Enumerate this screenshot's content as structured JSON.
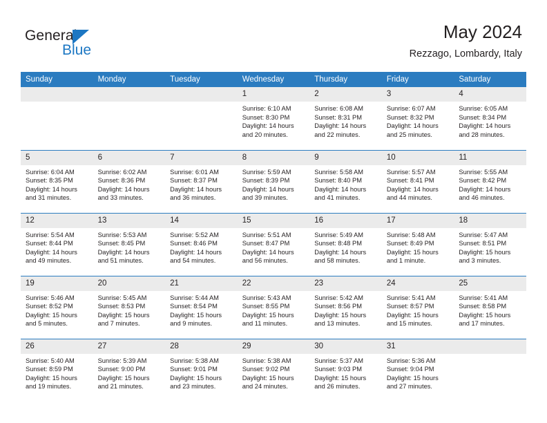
{
  "brand": {
    "name_top": "General",
    "name_bottom": "Blue",
    "triangle_color": "#1c77c3",
    "text_color": "#231f20"
  },
  "header": {
    "title": "May 2024",
    "subtitle": "Rezzago, Lombardy, Italy"
  },
  "theme": {
    "header_blue": "#2b7cc0",
    "daynum_gray": "#ebebeb",
    "text": "#231f20"
  },
  "weekday_headers": [
    "Sunday",
    "Monday",
    "Tuesday",
    "Wednesday",
    "Thursday",
    "Friday",
    "Saturday"
  ],
  "weeks": [
    [
      {
        "day": "",
        "lines": []
      },
      {
        "day": "",
        "lines": []
      },
      {
        "day": "",
        "lines": []
      },
      {
        "day": "1",
        "lines": [
          "Sunrise: 6:10 AM",
          "Sunset: 8:30 PM",
          "Daylight: 14 hours and 20 minutes."
        ]
      },
      {
        "day": "2",
        "lines": [
          "Sunrise: 6:08 AM",
          "Sunset: 8:31 PM",
          "Daylight: 14 hours and 22 minutes."
        ]
      },
      {
        "day": "3",
        "lines": [
          "Sunrise: 6:07 AM",
          "Sunset: 8:32 PM",
          "Daylight: 14 hours and 25 minutes."
        ]
      },
      {
        "day": "4",
        "lines": [
          "Sunrise: 6:05 AM",
          "Sunset: 8:34 PM",
          "Daylight: 14 hours and 28 minutes."
        ]
      }
    ],
    [
      {
        "day": "5",
        "lines": [
          "Sunrise: 6:04 AM",
          "Sunset: 8:35 PM",
          "Daylight: 14 hours and 31 minutes."
        ]
      },
      {
        "day": "6",
        "lines": [
          "Sunrise: 6:02 AM",
          "Sunset: 8:36 PM",
          "Daylight: 14 hours and 33 minutes."
        ]
      },
      {
        "day": "7",
        "lines": [
          "Sunrise: 6:01 AM",
          "Sunset: 8:37 PM",
          "Daylight: 14 hours and 36 minutes."
        ]
      },
      {
        "day": "8",
        "lines": [
          "Sunrise: 5:59 AM",
          "Sunset: 8:39 PM",
          "Daylight: 14 hours and 39 minutes."
        ]
      },
      {
        "day": "9",
        "lines": [
          "Sunrise: 5:58 AM",
          "Sunset: 8:40 PM",
          "Daylight: 14 hours and 41 minutes."
        ]
      },
      {
        "day": "10",
        "lines": [
          "Sunrise: 5:57 AM",
          "Sunset: 8:41 PM",
          "Daylight: 14 hours and 44 minutes."
        ]
      },
      {
        "day": "11",
        "lines": [
          "Sunrise: 5:55 AM",
          "Sunset: 8:42 PM",
          "Daylight: 14 hours and 46 minutes."
        ]
      }
    ],
    [
      {
        "day": "12",
        "lines": [
          "Sunrise: 5:54 AM",
          "Sunset: 8:44 PM",
          "Daylight: 14 hours and 49 minutes."
        ]
      },
      {
        "day": "13",
        "lines": [
          "Sunrise: 5:53 AM",
          "Sunset: 8:45 PM",
          "Daylight: 14 hours and 51 minutes."
        ]
      },
      {
        "day": "14",
        "lines": [
          "Sunrise: 5:52 AM",
          "Sunset: 8:46 PM",
          "Daylight: 14 hours and 54 minutes."
        ]
      },
      {
        "day": "15",
        "lines": [
          "Sunrise: 5:51 AM",
          "Sunset: 8:47 PM",
          "Daylight: 14 hours and 56 minutes."
        ]
      },
      {
        "day": "16",
        "lines": [
          "Sunrise: 5:49 AM",
          "Sunset: 8:48 PM",
          "Daylight: 14 hours and 58 minutes."
        ]
      },
      {
        "day": "17",
        "lines": [
          "Sunrise: 5:48 AM",
          "Sunset: 8:49 PM",
          "Daylight: 15 hours and 1 minute."
        ]
      },
      {
        "day": "18",
        "lines": [
          "Sunrise: 5:47 AM",
          "Sunset: 8:51 PM",
          "Daylight: 15 hours and 3 minutes."
        ]
      }
    ],
    [
      {
        "day": "19",
        "lines": [
          "Sunrise: 5:46 AM",
          "Sunset: 8:52 PM",
          "Daylight: 15 hours and 5 minutes."
        ]
      },
      {
        "day": "20",
        "lines": [
          "Sunrise: 5:45 AM",
          "Sunset: 8:53 PM",
          "Daylight: 15 hours and 7 minutes."
        ]
      },
      {
        "day": "21",
        "lines": [
          "Sunrise: 5:44 AM",
          "Sunset: 8:54 PM",
          "Daylight: 15 hours and 9 minutes."
        ]
      },
      {
        "day": "22",
        "lines": [
          "Sunrise: 5:43 AM",
          "Sunset: 8:55 PM",
          "Daylight: 15 hours and 11 minutes."
        ]
      },
      {
        "day": "23",
        "lines": [
          "Sunrise: 5:42 AM",
          "Sunset: 8:56 PM",
          "Daylight: 15 hours and 13 minutes."
        ]
      },
      {
        "day": "24",
        "lines": [
          "Sunrise: 5:41 AM",
          "Sunset: 8:57 PM",
          "Daylight: 15 hours and 15 minutes."
        ]
      },
      {
        "day": "25",
        "lines": [
          "Sunrise: 5:41 AM",
          "Sunset: 8:58 PM",
          "Daylight: 15 hours and 17 minutes."
        ]
      }
    ],
    [
      {
        "day": "26",
        "lines": [
          "Sunrise: 5:40 AM",
          "Sunset: 8:59 PM",
          "Daylight: 15 hours and 19 minutes."
        ]
      },
      {
        "day": "27",
        "lines": [
          "Sunrise: 5:39 AM",
          "Sunset: 9:00 PM",
          "Daylight: 15 hours and 21 minutes."
        ]
      },
      {
        "day": "28",
        "lines": [
          "Sunrise: 5:38 AM",
          "Sunset: 9:01 PM",
          "Daylight: 15 hours and 23 minutes."
        ]
      },
      {
        "day": "29",
        "lines": [
          "Sunrise: 5:38 AM",
          "Sunset: 9:02 PM",
          "Daylight: 15 hours and 24 minutes."
        ]
      },
      {
        "day": "30",
        "lines": [
          "Sunrise: 5:37 AM",
          "Sunset: 9:03 PM",
          "Daylight: 15 hours and 26 minutes."
        ]
      },
      {
        "day": "31",
        "lines": [
          "Sunrise: 5:36 AM",
          "Sunset: 9:04 PM",
          "Daylight: 15 hours and 27 minutes."
        ]
      },
      {
        "day": "",
        "lines": []
      }
    ]
  ]
}
